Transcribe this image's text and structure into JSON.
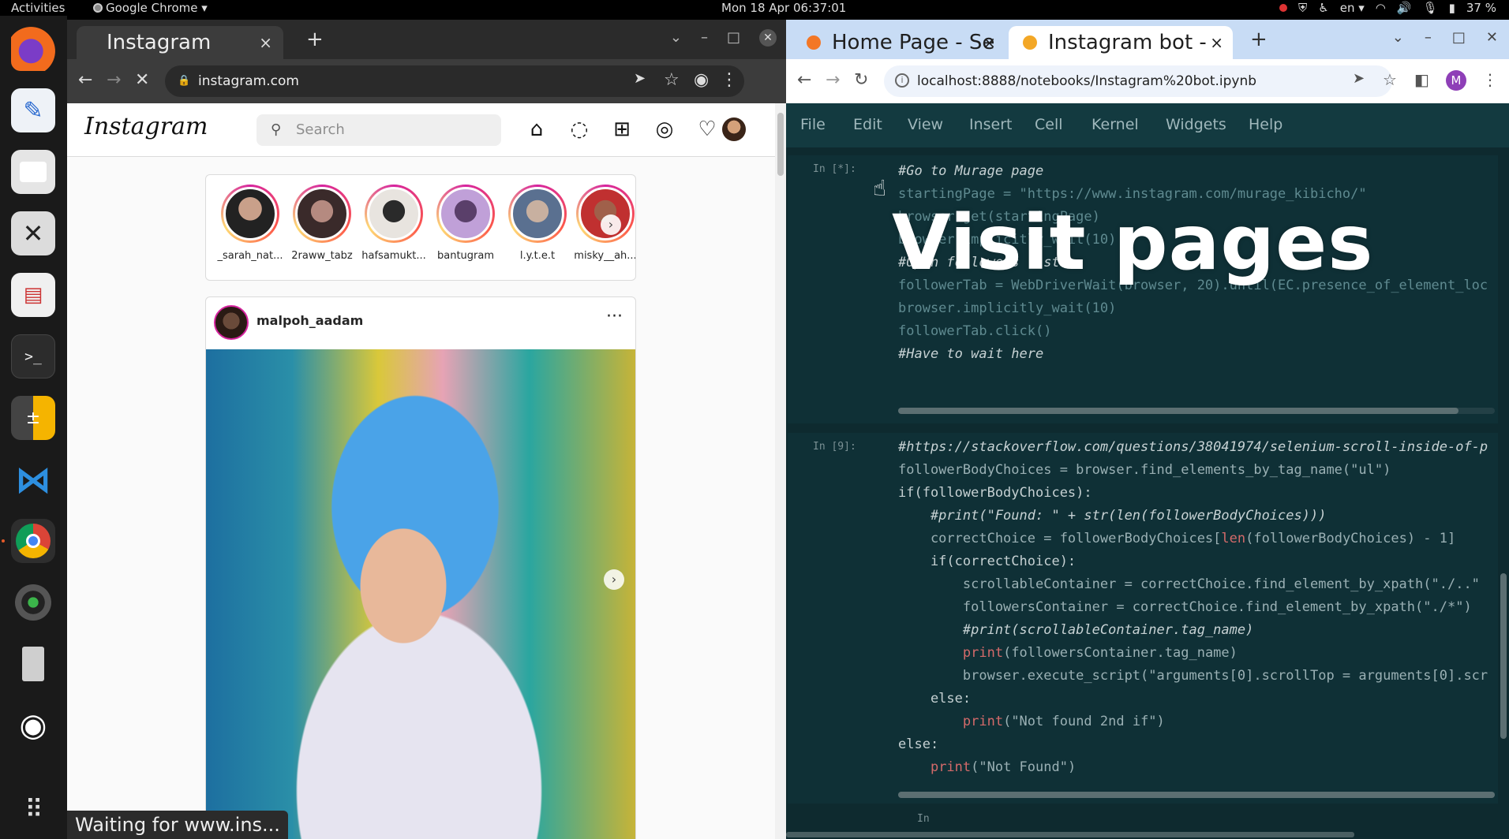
{
  "topbar": {
    "activities": "Activities",
    "app_name": "Google Chrome ▾",
    "clock": "Mon 18 Apr  06:37:01",
    "lang": "en ▾",
    "battery": "37 %"
  },
  "left_browser": {
    "tab_title": "Instagram",
    "tab_close": "×",
    "new_tab": "+",
    "url": "instagram.com",
    "status": "Waiting for www.ins..."
  },
  "instagram": {
    "logo": "Instagram",
    "search_placeholder": "Search",
    "stories": [
      {
        "name": "_sarah_nat..."
      },
      {
        "name": "2raww_tabz"
      },
      {
        "name": "hafsamukt..."
      },
      {
        "name": "bantugram"
      },
      {
        "name": "l.y.t.e.t"
      },
      {
        "name": "misky__ah..."
      }
    ],
    "post_user": "malpoh_aadam",
    "post_more": "···"
  },
  "right_browser": {
    "tab1_title": "Home Page - Se",
    "tab2_title": "Instagram bot -",
    "tab_close": "×",
    "new_tab": "+",
    "url": "localhost:8888/notebooks/Instagram%20bot.ipynb",
    "profile_initial": "M"
  },
  "jupyter": {
    "menu": [
      "File",
      "Edit",
      "View",
      "Insert",
      "Cell",
      "Kernel",
      "Widgets",
      "Help"
    ],
    "cell1_prompt": "In [*]:",
    "cell2_prompt": "In [9]:",
    "cell3_prompt": "In"
  },
  "overlay": {
    "title": "Visit pages"
  },
  "colors": {
    "jupyter_bg": "#0e2a2f",
    "chrome_light_tabbar": "#c8dcf5",
    "instagram_ring": "#d6249f"
  }
}
